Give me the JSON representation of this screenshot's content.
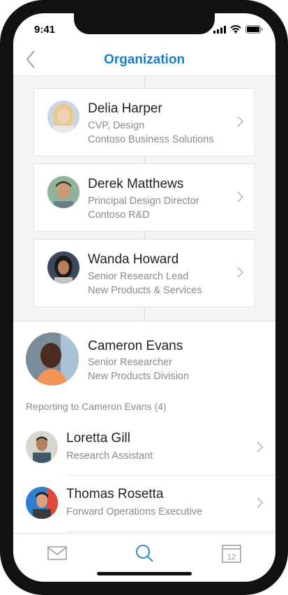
{
  "status_bar": {
    "time": "9:41"
  },
  "navbar": {
    "title": "Organization",
    "back_icon": "chevron-left-icon"
  },
  "colors": {
    "accent": "#1a7dc8",
    "secondary_text": "#8a8a8a",
    "chain_background": "#f4f4f4"
  },
  "chain": [
    {
      "name": "Delia Harper",
      "title": "CVP, Design",
      "department": "Contoso Business Solutions"
    },
    {
      "name": "Derek Matthews",
      "title": "Principal Design Director",
      "department": "Contoso R&D"
    },
    {
      "name": "Wanda Howard",
      "title": "Senior Research Lead",
      "department": "New Products & Services"
    }
  ],
  "focus": {
    "name": "Cameron Evans",
    "title": "Senior Researcher",
    "department": "New Products Division"
  },
  "reports": {
    "header": "Reporting to Cameron Evans (4)",
    "items": [
      {
        "name": "Loretta Gill",
        "title": "Research Assistant"
      },
      {
        "name": "Thomas Rosetta",
        "title": "Forward Operations Executive"
      }
    ]
  },
  "tabbar": {
    "items": [
      {
        "icon": "mail-icon",
        "active": false
      },
      {
        "icon": "search-icon",
        "active": true
      },
      {
        "icon": "calendar-icon",
        "active": false,
        "label": "12"
      }
    ]
  }
}
